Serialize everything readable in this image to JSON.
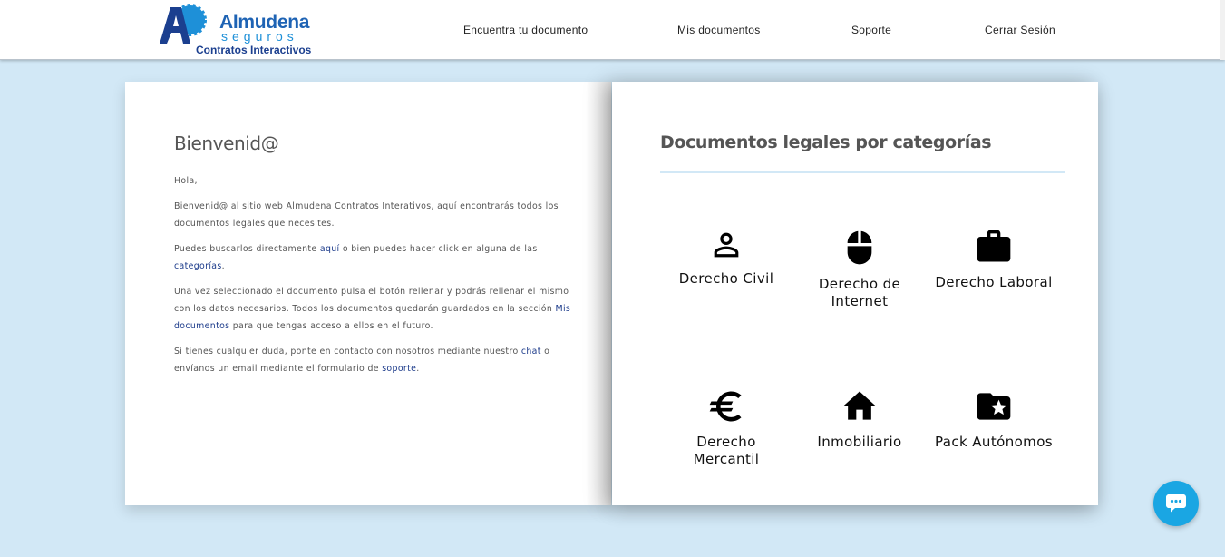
{
  "header": {
    "logo": {
      "name": "Almudena",
      "sub": "seguros",
      "tagline": "Contratos Interactivos",
      "mark_letter": "A",
      "colors": {
        "primary": "#1e63b4",
        "light": "#1e90d8",
        "dark": "#1b3f8f"
      }
    },
    "nav": [
      {
        "label": "Encuentra tu documento"
      },
      {
        "label": "Mis documentos"
      },
      {
        "label": "Soporte"
      },
      {
        "label": "Cerrar Sesión"
      }
    ]
  },
  "welcome": {
    "title": "Bienvenid@",
    "greeting": "Hola,",
    "p1": "Bienvenid@ al sitio web Almudena Contratos Interativos, aquí encontrarás todos los documentos legales que necesites.",
    "p2_before": "Puedes buscarlos directamente ",
    "p2_link1": "aquí",
    "p2_middle": " o bien puedes hacer click en alguna de las ",
    "p2_link2": "categorías",
    "p2_after": ".",
    "p3_before": "Una vez seleccionado el documento pulsa el botón rellenar y podrás rellenar el mismo con los datos necesarios. Todos los documentos quedarán guardados en la sección ",
    "p3_link": "Mis documentos",
    "p3_after": " para que tengas acceso a ellos en el futuro.",
    "p4_before": "Si tienes cualquier duda, ponte en contacto con nosotros mediante nuestro ",
    "p4_link1": "chat",
    "p4_middle": " o envíanos un email mediante el formulario de ",
    "p4_link2": "soporte",
    "p4_after": "."
  },
  "categories": {
    "title": "Documentos legales por categorías",
    "items": [
      {
        "label": "Derecho Civil",
        "icon": "person-icon"
      },
      {
        "label": "Derecho de Internet",
        "icon": "mouse-icon"
      },
      {
        "label": "Derecho Laboral",
        "icon": "briefcase-icon"
      },
      {
        "label": "Derecho Mercantil",
        "icon": "euro-icon"
      },
      {
        "label": "Inmobiliario",
        "icon": "home-icon"
      },
      {
        "label": "Pack Autónomos",
        "icon": "folder-star-icon"
      }
    ]
  },
  "colors": {
    "background": "#d2e8f6",
    "link": "#1b3a8a",
    "chat": "#1aa6e3"
  }
}
